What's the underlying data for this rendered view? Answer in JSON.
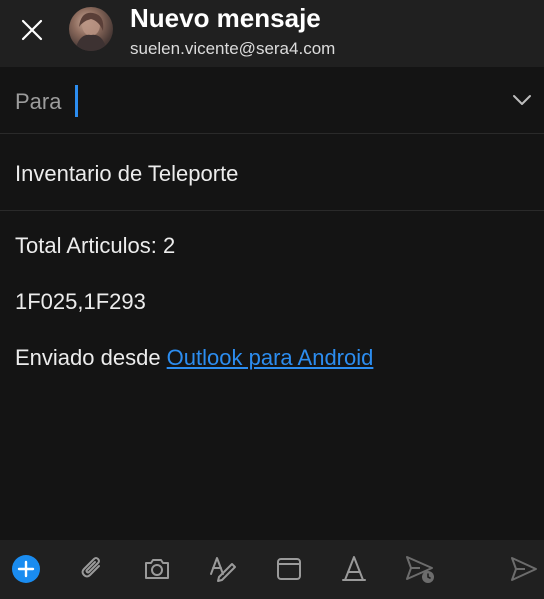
{
  "header": {
    "title": "Nuevo mensaje",
    "account": "suelen.vicente@sera4.com"
  },
  "to_field": {
    "label": "Para",
    "value": ""
  },
  "subject": "Inventario de Teleporte",
  "body": {
    "line1": "Total Articulos: 2",
    "line2": "1F025,1F293",
    "signature_prefix": "Enviado desde ",
    "signature_link": "Outlook para Android"
  },
  "toolbar": {
    "icons": [
      "add-icon",
      "attach-icon",
      "camera-icon",
      "draw-icon",
      "calendar-icon",
      "format-icon",
      "schedule-send-icon",
      "send-icon"
    ]
  },
  "colors": {
    "accent": "#2c8df0",
    "background": "#141414",
    "header": "#202020"
  }
}
